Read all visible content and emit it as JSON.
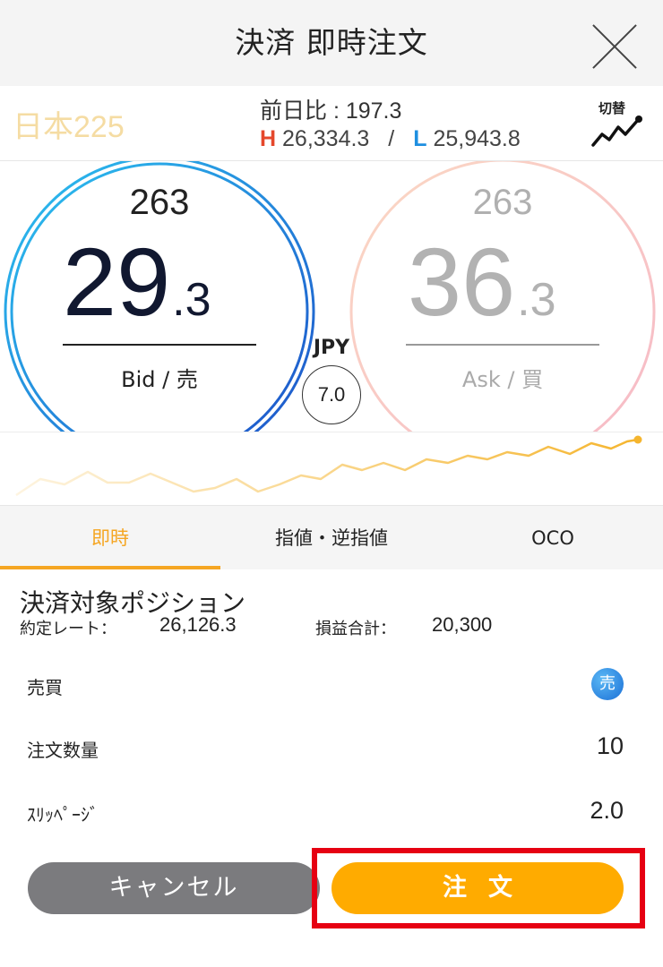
{
  "header": {
    "title": "決済 即時注文"
  },
  "instrument": {
    "name": "日本225",
    "prev_label": "前日比 : ",
    "prev_value": "197.3",
    "high_letter": "H",
    "high_value": "26,334.3",
    "separator": "/",
    "low_letter": "L",
    "low_value": "25,943.8",
    "switch_label": "切替",
    "switch_icon": "trend-chart-icon"
  },
  "quote": {
    "bid_small": "263",
    "bid_big": "29",
    "bid_decimal": ".3",
    "bid_label": "Bid / 売",
    "ask_small": "263",
    "ask_big": "36",
    "ask_decimal": ".3",
    "ask_label": "Ask / 買",
    "currency": "JPY",
    "spread": "7.0",
    "bid_color": "#1e8fe0",
    "ask_color": "#f3b3b8"
  },
  "sparkline": {
    "color": "#f5b52e"
  },
  "tabs": [
    {
      "label": "即時",
      "active": true
    },
    {
      "label": "指値・逆指値",
      "active": false
    },
    {
      "label": "OCO",
      "active": false
    }
  ],
  "position": {
    "title": "決済対象ポジション",
    "rate_label": "約定レート：",
    "rate_value": "26,126.3",
    "pnl_label": "損益合計：",
    "pnl_value": "20,300"
  },
  "form": {
    "side_label": "売買",
    "side_badge": "売",
    "quantity_label": "注文数量",
    "quantity_value": "10",
    "slippage_label": "ｽﾘｯﾍﾟｰｼﾞ",
    "slippage_value": "2.0"
  },
  "buttons": {
    "cancel_label": "キャンセル",
    "order_label": "注文"
  },
  "colors": {
    "accent": "#f5a623",
    "order_button": "#ffab00",
    "cancel_button": "#7b7b7e",
    "highlight_border": "#e60012"
  }
}
